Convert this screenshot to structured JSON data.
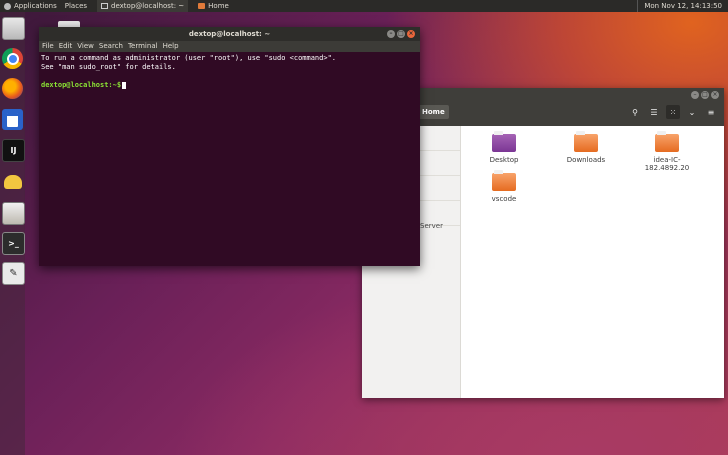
{
  "top_panel": {
    "applications": "Applications",
    "places": "Places",
    "task_terminal": "dextop@localhost: ~",
    "task_home": "Home",
    "clock": "Mon Nov 12, 14:13:50"
  },
  "launcher": {
    "items": [
      "files-icon",
      "chrome-icon",
      "firefox-icon",
      "docs-icon",
      "intellij-icon",
      "teapot-icon",
      "archive-icon",
      "terminal-icon",
      "text-editor-icon"
    ],
    "idea_label": "IJ",
    "term_label": ">_"
  },
  "terminal": {
    "title": "dextop@localhost: ~",
    "menu": [
      "File",
      "Edit",
      "View",
      "Search",
      "Terminal",
      "Help"
    ],
    "line1": "To run a command as administrator (user \"root\"), use \"sudo <command>\".",
    "line2": "See \"man sudo_root\" for details.",
    "prompt": "dextop@localhost:~$"
  },
  "file_manager": {
    "breadcrumb": "Home",
    "sidebar_partial_label": "Server",
    "files": [
      {
        "name": "Desktop",
        "color": "#8e44ad"
      },
      {
        "name": "Downloads",
        "color": "#e56b21"
      },
      {
        "name": "idea-IC-182.4892.20",
        "color": "#e56b21"
      },
      {
        "name": "vscode",
        "color": "#e56b21"
      }
    ]
  },
  "window_buttons": {
    "minimize": "–",
    "maximize": "□",
    "close": "×"
  }
}
